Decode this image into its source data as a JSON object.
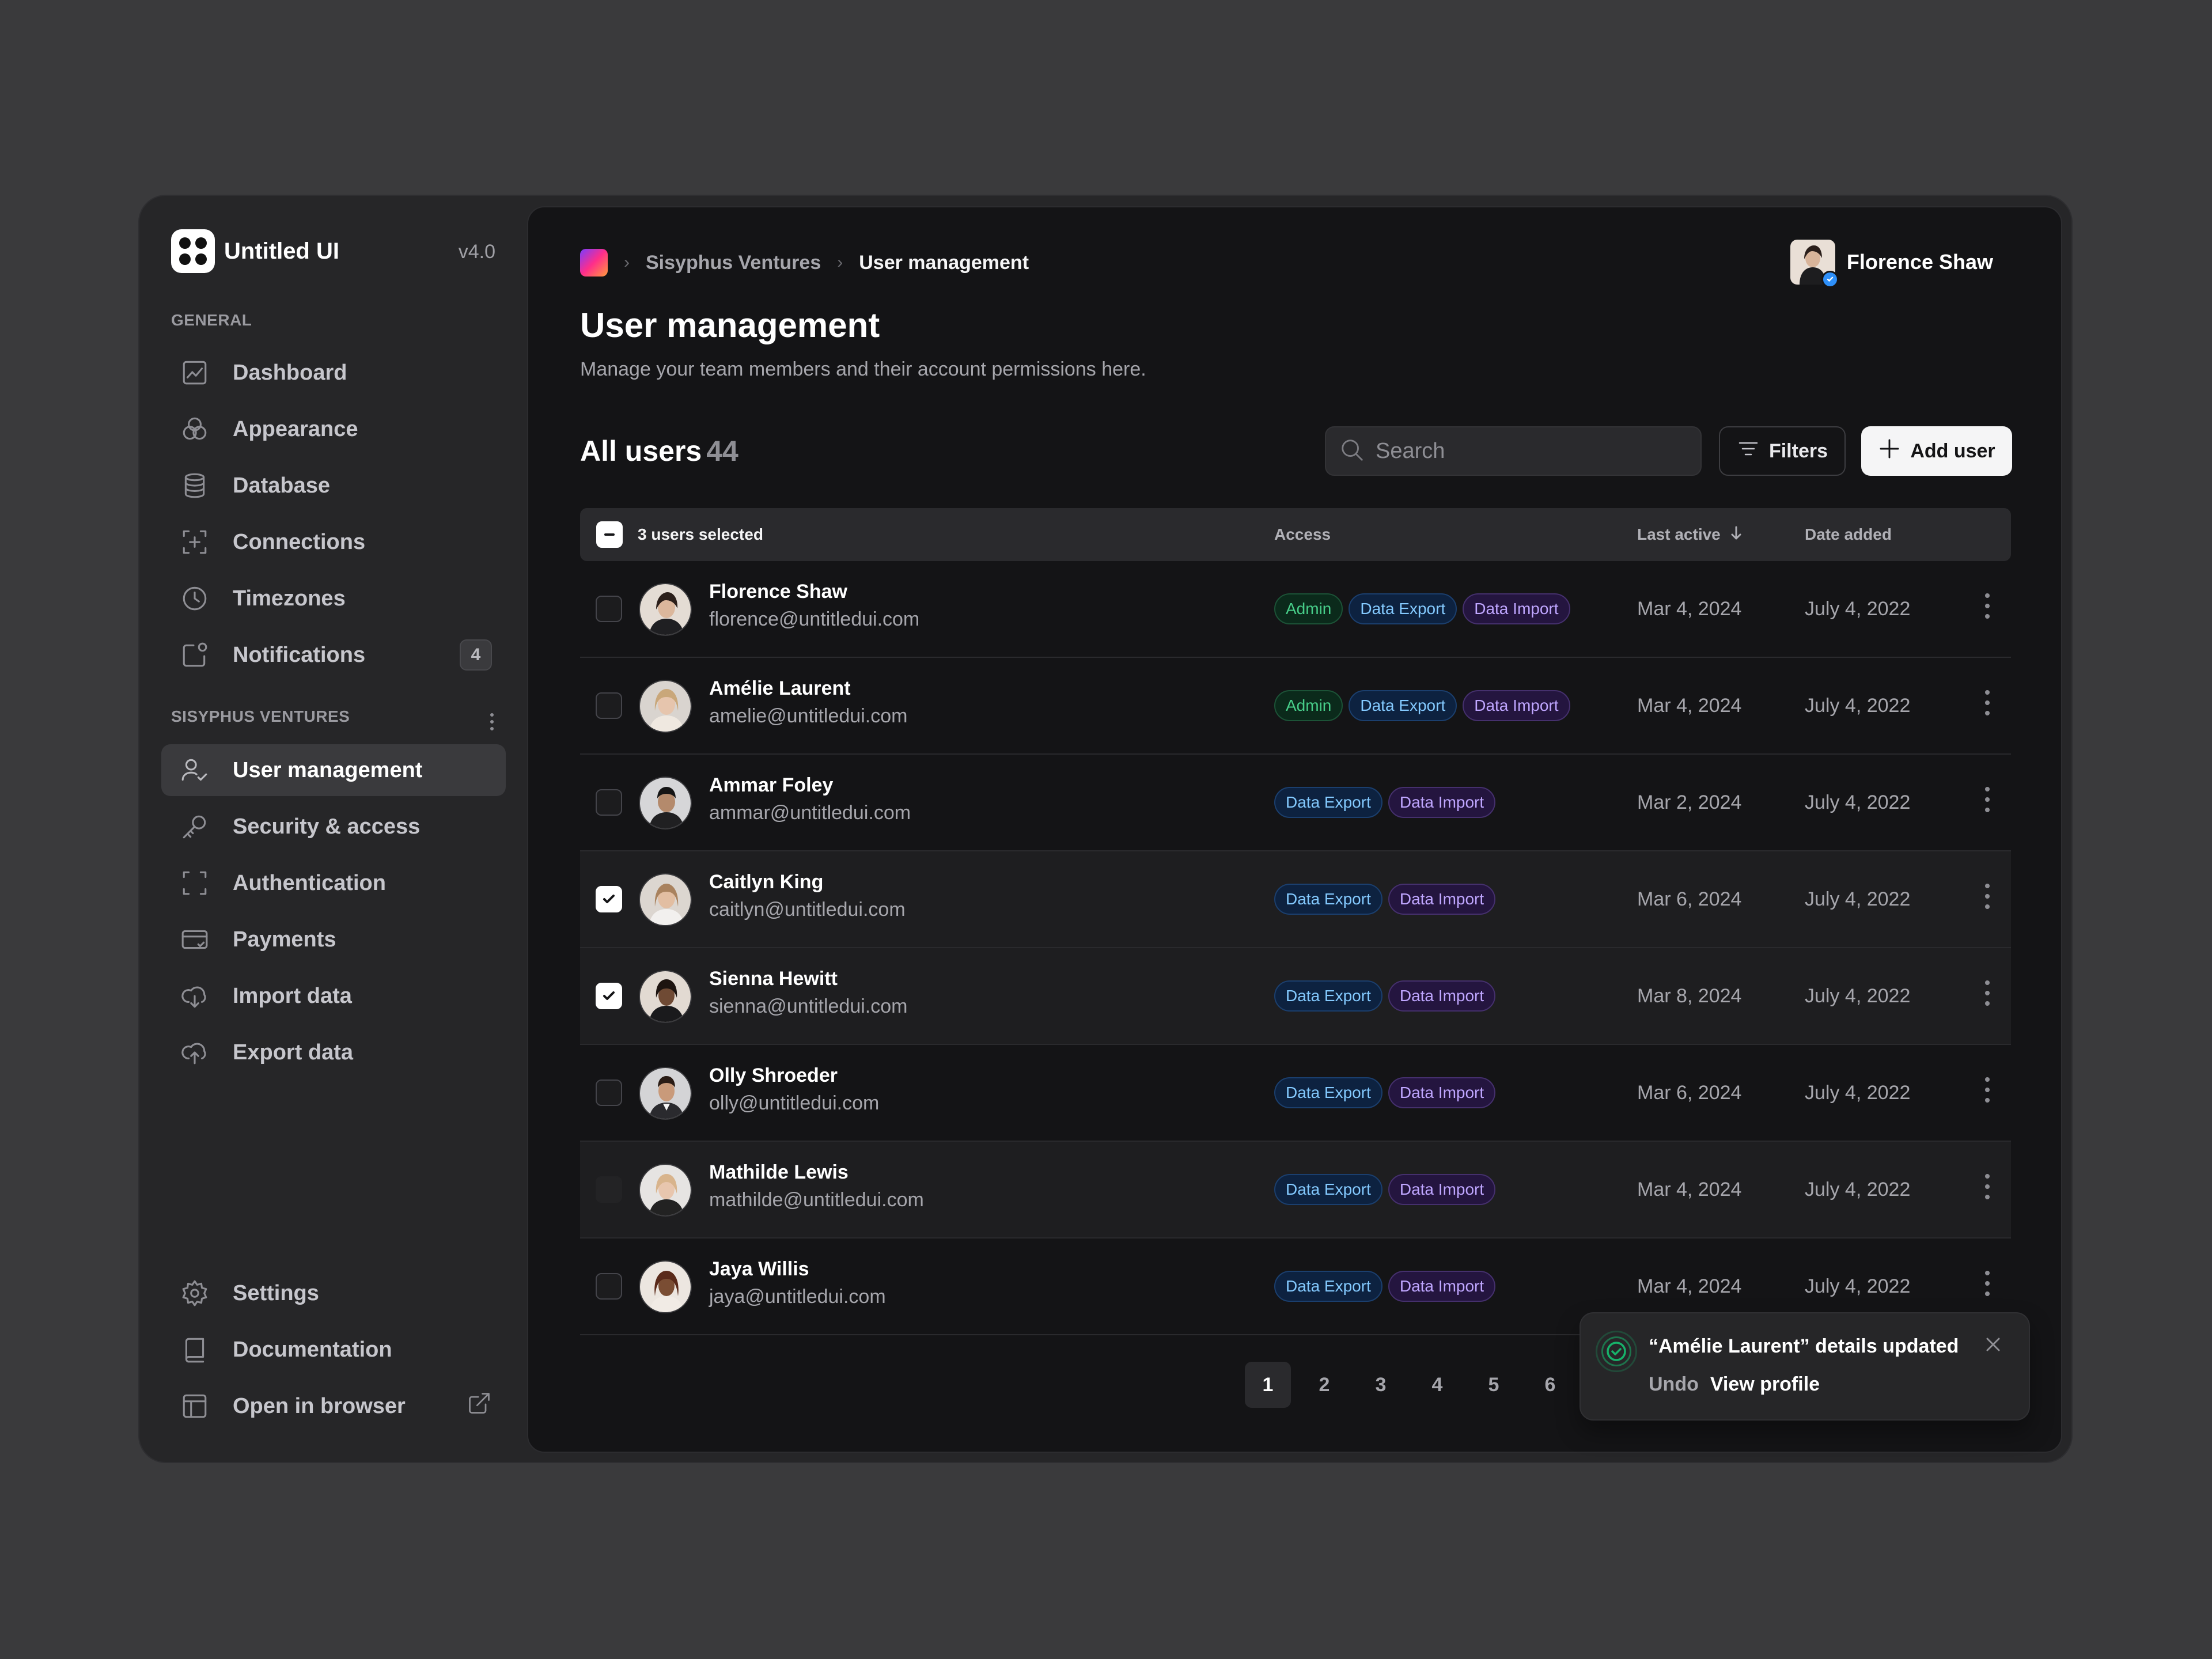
{
  "brand": {
    "name": "Untitled UI",
    "version": "v4.0"
  },
  "sidebar": {
    "general_label": "GENERAL",
    "general_items": [
      {
        "label": "Dashboard",
        "icon": "chart-icon"
      },
      {
        "label": "Appearance",
        "icon": "palette-icon"
      },
      {
        "label": "Database",
        "icon": "database-icon"
      },
      {
        "label": "Connections",
        "icon": "connections-icon"
      },
      {
        "label": "Timezones",
        "icon": "clock-icon"
      },
      {
        "label": "Notifications",
        "icon": "notification-icon",
        "badge": "4"
      }
    ],
    "org_label": "SISYPHUS VENTURES",
    "org_items": [
      {
        "label": "User management",
        "icon": "users-icon",
        "active": true
      },
      {
        "label": "Security & access",
        "icon": "key-icon"
      },
      {
        "label": "Authentication",
        "icon": "scan-icon"
      },
      {
        "label": "Payments",
        "icon": "credit-card-icon"
      },
      {
        "label": "Import data",
        "icon": "cloud-download-icon"
      },
      {
        "label": "Export data",
        "icon": "cloud-upload-icon"
      }
    ],
    "footer_items": [
      {
        "label": "Settings",
        "icon": "gear-icon"
      },
      {
        "label": "Documentation",
        "icon": "book-icon"
      },
      {
        "label": "Open in browser",
        "icon": "layout-icon"
      }
    ]
  },
  "breadcrumb": {
    "org": "Sisyphus Ventures",
    "current": "User management"
  },
  "profile": {
    "name": "Florence Shaw"
  },
  "page": {
    "title": "User management",
    "subtitle": "Manage your team members and their account permissions here."
  },
  "toolbar": {
    "title": "All users",
    "count": "44",
    "search_placeholder": "Search",
    "filters_label": "Filters",
    "add_label": "Add user"
  },
  "table": {
    "selected_label": "3 users selected",
    "col_access": "Access",
    "col_last_active": "Last active",
    "col_date_added": "Date added",
    "rows": [
      {
        "name": "Florence Shaw",
        "email": "florence@untitledui.com",
        "access": [
          "Admin",
          "Data Export",
          "Data Import"
        ],
        "last_active": "Mar 4, 2024",
        "date_added": "July 4, 2022",
        "checked": false
      },
      {
        "name": "Amélie Laurent",
        "email": "amelie@untitledui.com",
        "access": [
          "Admin",
          "Data Export",
          "Data Import"
        ],
        "last_active": "Mar 4, 2024",
        "date_added": "July 4, 2022",
        "checked": false
      },
      {
        "name": "Ammar Foley",
        "email": "ammar@untitledui.com",
        "access": [
          "Data Export",
          "Data Import"
        ],
        "last_active": "Mar 2, 2024",
        "date_added": "July 4, 2022",
        "checked": false
      },
      {
        "name": "Caitlyn King",
        "email": "caitlyn@untitledui.com",
        "access": [
          "Data Export",
          "Data Import"
        ],
        "last_active": "Mar 6, 2024",
        "date_added": "July 4, 2022",
        "checked": true
      },
      {
        "name": "Sienna Hewitt",
        "email": "sienna@untitledui.com",
        "access": [
          "Data Export",
          "Data Import"
        ],
        "last_active": "Mar 8, 2024",
        "date_added": "July 4, 2022",
        "checked": true
      },
      {
        "name": "Olly Shroeder",
        "email": "olly@untitledui.com",
        "access": [
          "Data Export",
          "Data Import"
        ],
        "last_active": "Mar 6, 2024",
        "date_added": "July 4, 2022",
        "checked": false
      },
      {
        "name": "Mathilde Lewis",
        "email": "mathilde@untitledui.com",
        "access": [
          "Data Export",
          "Data Import"
        ],
        "last_active": "Mar 4, 2024",
        "date_added": "July 4, 2022",
        "checked": true
      },
      {
        "name": "Jaya Willis",
        "email": "jaya@untitledui.com",
        "access": [
          "Data Export",
          "Data Import"
        ],
        "last_active": "Mar 4, 2024",
        "date_added": "July 4, 2022",
        "checked": false
      }
    ]
  },
  "pagination": {
    "pages": [
      "1",
      "2",
      "3",
      "4",
      "5",
      "6"
    ],
    "current": "1"
  },
  "toast": {
    "title": "“Amélie Laurent” details updated",
    "undo_label": "Undo",
    "view_label": "View profile"
  },
  "colors": {
    "admin": "#47cd89",
    "data_export": "#84caff",
    "data_import": "#bfa6ff",
    "success": "#17b26a"
  }
}
